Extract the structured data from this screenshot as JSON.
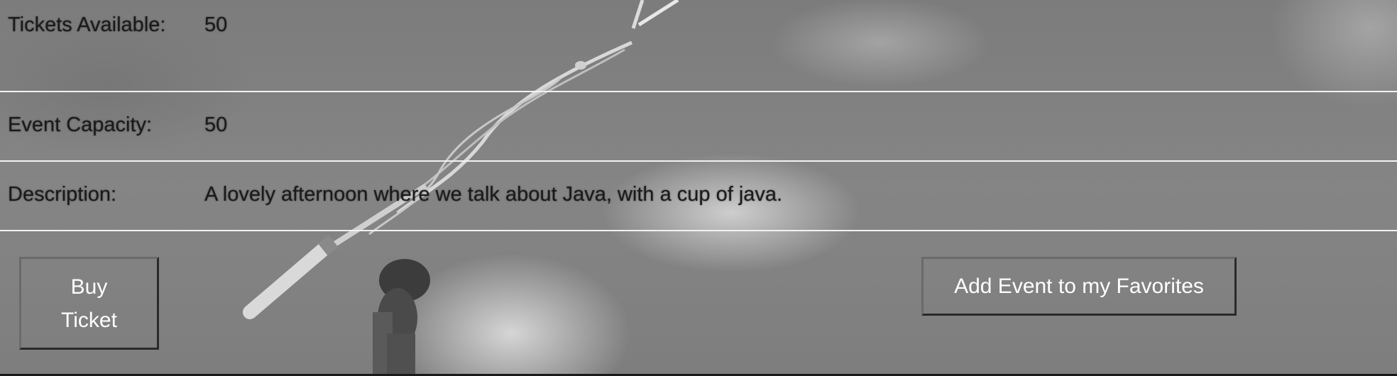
{
  "event_details": {
    "rows": [
      {
        "label": "Tickets Available:",
        "value": "50"
      },
      {
        "label": "Event Capacity:",
        "value": "50"
      },
      {
        "label": "Description:",
        "value": "A lovely afternoon where we talk about Java, with a cup of java."
      }
    ]
  },
  "actions": {
    "buy_ticket_label": "Buy Ticket",
    "add_favorite_label": "Add Event to my Favorites"
  },
  "background": {
    "image": "microphone-on-stage-photo",
    "tone": "grayscale"
  },
  "colors": {
    "divider": "#f2f2f2",
    "label_text": "#1a1a1a",
    "button_text": "#ffffff"
  }
}
